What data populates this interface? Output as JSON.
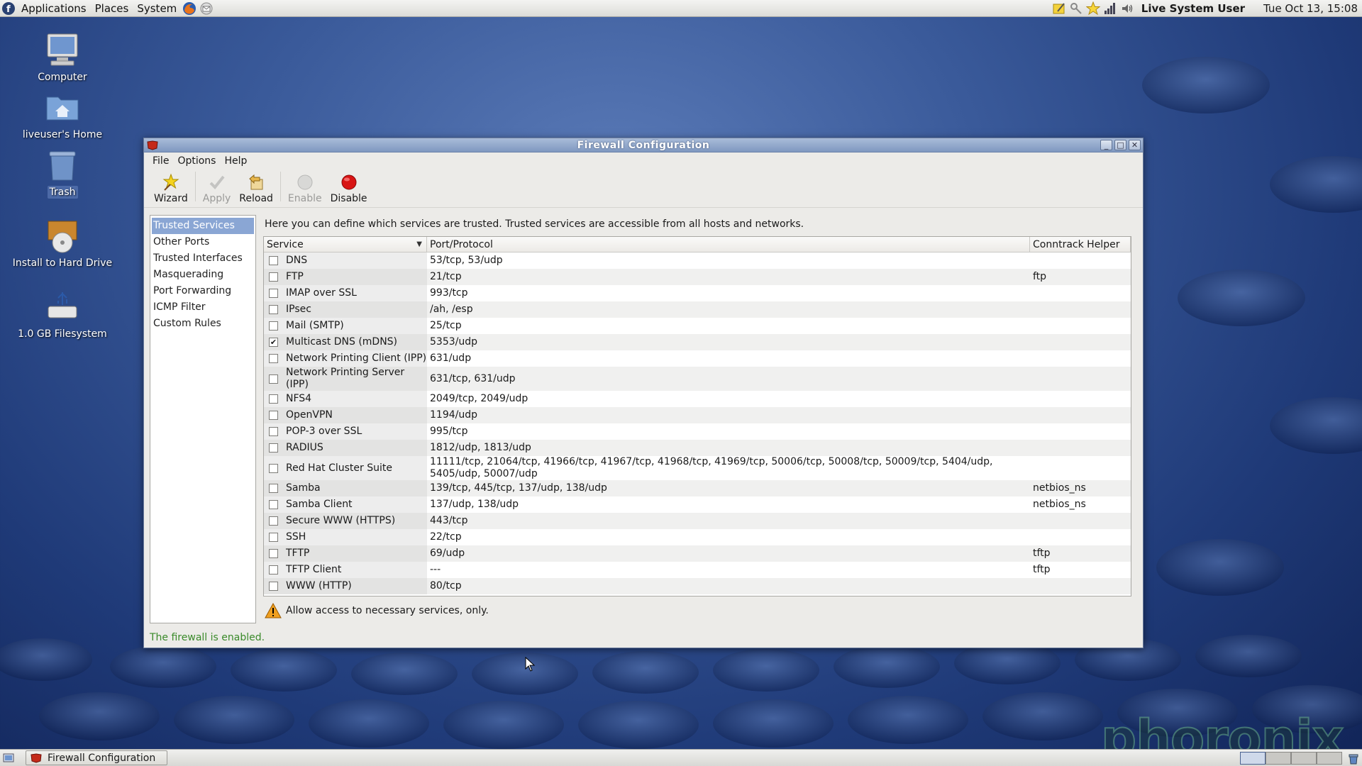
{
  "top_panel": {
    "menus": [
      "Applications",
      "Places",
      "System"
    ],
    "user": "Live System User",
    "clock": "Tue Oct 13, 15:08"
  },
  "desktop_icons": [
    {
      "label": "Computer"
    },
    {
      "label": "liveuser's Home"
    },
    {
      "label": "Trash"
    },
    {
      "label": "Install to Hard Drive"
    },
    {
      "label": "1.0 GB Filesystem"
    }
  ],
  "window": {
    "title": "Firewall Configuration",
    "menu": [
      "File",
      "Options",
      "Help"
    ],
    "toolbar": {
      "wizard": "Wizard",
      "apply": "Apply",
      "reload": "Reload",
      "enable": "Enable",
      "disable": "Disable"
    },
    "sidebar": [
      "Trusted Services",
      "Other Ports",
      "Trusted Interfaces",
      "Masquerading",
      "Port Forwarding",
      "ICMP Filter",
      "Custom Rules"
    ],
    "description": "Here you can define which services are trusted. Trusted services are accessible from all hosts and networks.",
    "table": {
      "headers": [
        "Service",
        "Port/Protocol",
        "Conntrack Helper"
      ],
      "rows": [
        {
          "service": "DNS",
          "port": "53/tcp, 53/udp",
          "helper": "",
          "checked": false
        },
        {
          "service": "FTP",
          "port": "21/tcp",
          "helper": "ftp",
          "checked": false
        },
        {
          "service": "IMAP over SSL",
          "port": "993/tcp",
          "helper": "",
          "checked": false
        },
        {
          "service": "IPsec",
          "port": "/ah, /esp",
          "helper": "",
          "checked": false
        },
        {
          "service": "Mail (SMTP)",
          "port": "25/tcp",
          "helper": "",
          "checked": false
        },
        {
          "service": "Multicast DNS (mDNS)",
          "port": "5353/udp",
          "helper": "",
          "checked": true
        },
        {
          "service": "Network Printing Client (IPP)",
          "port": "631/udp",
          "helper": "",
          "checked": false
        },
        {
          "service": "Network Printing Server (IPP)",
          "port": "631/tcp, 631/udp",
          "helper": "",
          "checked": false
        },
        {
          "service": "NFS4",
          "port": "2049/tcp, 2049/udp",
          "helper": "",
          "checked": false
        },
        {
          "service": "OpenVPN",
          "port": "1194/udp",
          "helper": "",
          "checked": false
        },
        {
          "service": "POP-3 over SSL",
          "port": "995/tcp",
          "helper": "",
          "checked": false
        },
        {
          "service": "RADIUS",
          "port": "1812/udp, 1813/udp",
          "helper": "",
          "checked": false
        },
        {
          "service": "Red Hat Cluster Suite",
          "port": "11111/tcp, 21064/tcp, 41966/tcp, 41967/tcp, 41968/tcp, 41969/tcp, 50006/tcp, 50008/tcp, 50009/tcp, 5404/udp, 5405/udp, 50007/udp",
          "helper": "",
          "checked": false
        },
        {
          "service": "Samba",
          "port": "139/tcp, 445/tcp, 137/udp, 138/udp",
          "helper": "netbios_ns",
          "checked": false
        },
        {
          "service": "Samba Client",
          "port": "137/udp, 138/udp",
          "helper": "netbios_ns",
          "checked": false
        },
        {
          "service": "Secure WWW (HTTPS)",
          "port": "443/tcp",
          "helper": "",
          "checked": false
        },
        {
          "service": "SSH",
          "port": "22/tcp",
          "helper": "",
          "checked": false
        },
        {
          "service": "TFTP",
          "port": "69/udp",
          "helper": "tftp",
          "checked": false
        },
        {
          "service": "TFTP Client",
          "port": "---",
          "helper": "tftp",
          "checked": false
        },
        {
          "service": "WWW (HTTP)",
          "port": "80/tcp",
          "helper": "",
          "checked": false
        }
      ]
    },
    "warning": "Allow access to necessary services, only.",
    "status": "The firewall is enabled."
  },
  "taskbar": {
    "task": "Firewall Configuration"
  },
  "watermark": "phoronix",
  "colors": {
    "selection": "#8aa6d4",
    "status_green": "#3a8a2a",
    "disable_red": "#d81414"
  }
}
